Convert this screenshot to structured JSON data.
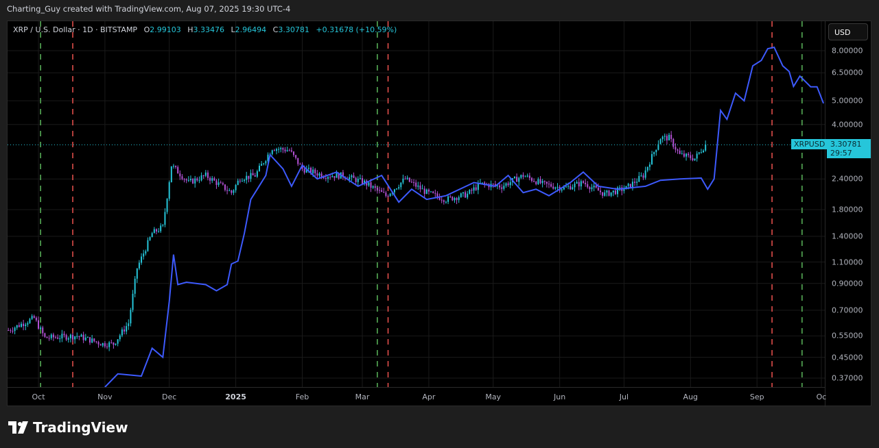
{
  "header": {
    "credit": "Charting_Guy created with TradingView.com, Aug 07, 2025 19:30 UTC-4"
  },
  "legend": {
    "symbol": "XRP / U.S. Dollar · 1D · BITSTAMP",
    "o_label": "O",
    "o": "2.99103",
    "h_label": "H",
    "h": "3.33476",
    "l_label": "L",
    "l": "2.96494",
    "c_label": "C",
    "c": "3.30781",
    "change": "+0.31678 (+10.59%)"
  },
  "price_axis": {
    "currency_button": "USD",
    "ticks": [
      "8.00000",
      "6.50000",
      "5.00000",
      "4.00000",
      "2.40000",
      "1.80000",
      "1.40000",
      "1.10000",
      "0.90000",
      "0.70000",
      "0.55000",
      "0.45000",
      "0.37000"
    ]
  },
  "last_price": {
    "symbol": "XRPUSD",
    "price": "3.30781",
    "countdown": "29:57"
  },
  "time_axis": {
    "ticks": [
      {
        "label": "Oct",
        "day": 0
      },
      {
        "label": "Nov",
        "day": 31
      },
      {
        "label": "Dec",
        "day": 61
      },
      {
        "label": "2025",
        "day": 92,
        "bold": true
      },
      {
        "label": "Feb",
        "day": 123
      },
      {
        "label": "Mar",
        "day": 151
      },
      {
        "label": "Apr",
        "day": 182
      },
      {
        "label": "May",
        "day": 212
      },
      {
        "label": "Jun",
        "day": 243
      },
      {
        "label": "Jul",
        "day": 273
      },
      {
        "label": "Aug",
        "day": 304
      },
      {
        "label": "Sep",
        "day": 335
      },
      {
        "label": "Oc",
        "day": 365
      }
    ]
  },
  "footer": {
    "brand": "TradingView"
  },
  "colors": {
    "up": "#26c6da",
    "down": "#b452d6",
    "overlay": "#3d5afe",
    "green_marker": "#5cb85c",
    "red_marker": "#ef5350"
  },
  "chart_data": {
    "type": "line",
    "scale": "log",
    "x_unit": "days since 2024-10-01",
    "ylim": [
      0.33,
      9.5
    ],
    "price_series": {
      "name": "XRPUSD daily",
      "points": [
        [
          -14,
          0.58
        ],
        [
          -2,
          0.65
        ],
        [
          3,
          0.54
        ],
        [
          18,
          0.55
        ],
        [
          30,
          0.51
        ],
        [
          35,
          0.51
        ],
        [
          42,
          0.62
        ],
        [
          46,
          1.04
        ],
        [
          53,
          1.44
        ],
        [
          58,
          1.53
        ],
        [
          62,
          2.73
        ],
        [
          70,
          2.32
        ],
        [
          78,
          2.48
        ],
        [
          90,
          2.11
        ],
        [
          94,
          2.42
        ],
        [
          101,
          2.48
        ],
        [
          109,
          3.21
        ],
        [
          117,
          3.14
        ],
        [
          123,
          2.64
        ],
        [
          133,
          2.48
        ],
        [
          142,
          2.48
        ],
        [
          152,
          2.32
        ],
        [
          162,
          2.05
        ],
        [
          171,
          2.4
        ],
        [
          181,
          2.11
        ],
        [
          190,
          1.98
        ],
        [
          200,
          2.08
        ],
        [
          206,
          2.29
        ],
        [
          216,
          2.24
        ],
        [
          226,
          2.48
        ],
        [
          235,
          2.29
        ],
        [
          245,
          2.2
        ],
        [
          254,
          2.32
        ],
        [
          264,
          2.08
        ],
        [
          274,
          2.2
        ],
        [
          282,
          2.48
        ],
        [
          290,
          3.53
        ],
        [
          294,
          3.53
        ],
        [
          299,
          3.01
        ],
        [
          306,
          2.91
        ],
        [
          311,
          3.31
        ]
      ]
    },
    "overlay_series": {
      "name": "overlay",
      "points": [
        [
          31,
          0.34
        ],
        [
          37,
          0.385
        ],
        [
          48,
          0.377
        ],
        [
          53,
          0.49
        ],
        [
          58,
          0.45
        ],
        [
          61,
          0.76
        ],
        [
          63,
          1.18
        ],
        [
          65,
          0.89
        ],
        [
          69,
          0.91
        ],
        [
          78,
          0.89
        ],
        [
          83,
          0.84
        ],
        [
          88,
          0.89
        ],
        [
          90,
          1.08
        ],
        [
          93,
          1.11
        ],
        [
          96,
          1.44
        ],
        [
          99,
          1.98
        ],
        [
          102,
          2.18
        ],
        [
          106,
          2.48
        ],
        [
          108,
          3.01
        ],
        [
          114,
          2.64
        ],
        [
          118,
          2.24
        ],
        [
          123,
          2.73
        ],
        [
          130,
          2.4
        ],
        [
          139,
          2.56
        ],
        [
          149,
          2.24
        ],
        [
          160,
          2.48
        ],
        [
          168,
          1.93
        ],
        [
          174,
          2.18
        ],
        [
          181,
          1.98
        ],
        [
          190,
          2.05
        ],
        [
          203,
          2.32
        ],
        [
          213,
          2.24
        ],
        [
          219,
          2.48
        ],
        [
          226,
          2.11
        ],
        [
          232,
          2.18
        ],
        [
          238,
          2.05
        ],
        [
          248,
          2.32
        ],
        [
          254,
          2.56
        ],
        [
          261,
          2.24
        ],
        [
          270,
          2.18
        ],
        [
          283,
          2.24
        ],
        [
          290,
          2.37
        ],
        [
          299,
          2.4
        ],
        [
          309,
          2.42
        ],
        [
          312,
          2.18
        ],
        [
          315,
          2.4
        ],
        [
          318,
          4.57
        ],
        [
          321,
          4.2
        ],
        [
          325,
          5.37
        ],
        [
          329,
          5.0
        ],
        [
          333,
          6.94
        ],
        [
          337,
          7.3
        ],
        [
          340,
          8.15
        ],
        [
          343,
          8.26
        ],
        [
          347,
          6.94
        ],
        [
          350,
          6.58
        ],
        [
          352,
          5.72
        ],
        [
          355,
          6.3
        ],
        [
          360,
          5.7
        ],
        [
          363,
          5.7
        ],
        [
          366,
          4.88
        ]
      ]
    },
    "cycle_markers": {
      "green_days": [
        1,
        158,
        356
      ],
      "red_days": [
        16,
        163,
        342
      ]
    }
  }
}
